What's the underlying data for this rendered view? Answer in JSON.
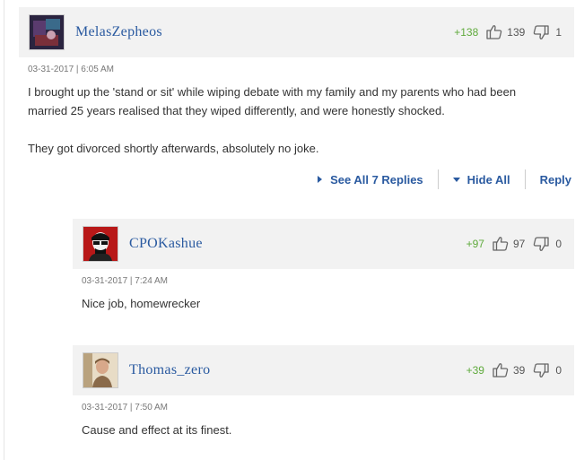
{
  "comments": [
    {
      "username": "MelasZepheos",
      "score": "+138",
      "likes": "139",
      "dislikes": "1",
      "timestamp": "03-31-2017 | 6:05 AM",
      "lines": [
        "I brought up the 'stand or sit' while wiping debate with my family and my parents who had been",
        "married 25 years realised that they wiped differently, and were honestly shocked.",
        "",
        "They got divorced shortly afterwards, absolutely no joke."
      ]
    },
    {
      "username": "CPOKashue",
      "score": "+97",
      "likes": "97",
      "dislikes": "0",
      "timestamp": "03-31-2017 | 7:24 AM",
      "lines": [
        "Nice job, homewrecker"
      ]
    },
    {
      "username": "Thomas_zero",
      "score": "+39",
      "likes": "39",
      "dislikes": "0",
      "timestamp": "03-31-2017 | 7:50 AM",
      "lines": [
        "Cause and effect at its finest."
      ]
    }
  ],
  "actions": {
    "see_all": "See All 7 Replies",
    "hide_all": "Hide All",
    "reply": "Reply"
  },
  "icons": {
    "upvote": "thumbs-up-icon",
    "downvote": "thumbs-down-icon",
    "see_all": "caret-right-icon",
    "hide_all": "caret-down-icon"
  },
  "colors": {
    "username": "#2a5aa0",
    "score": "#5faa3c",
    "header_bg": "#f2f2f2",
    "action": "#2a5aa0"
  }
}
